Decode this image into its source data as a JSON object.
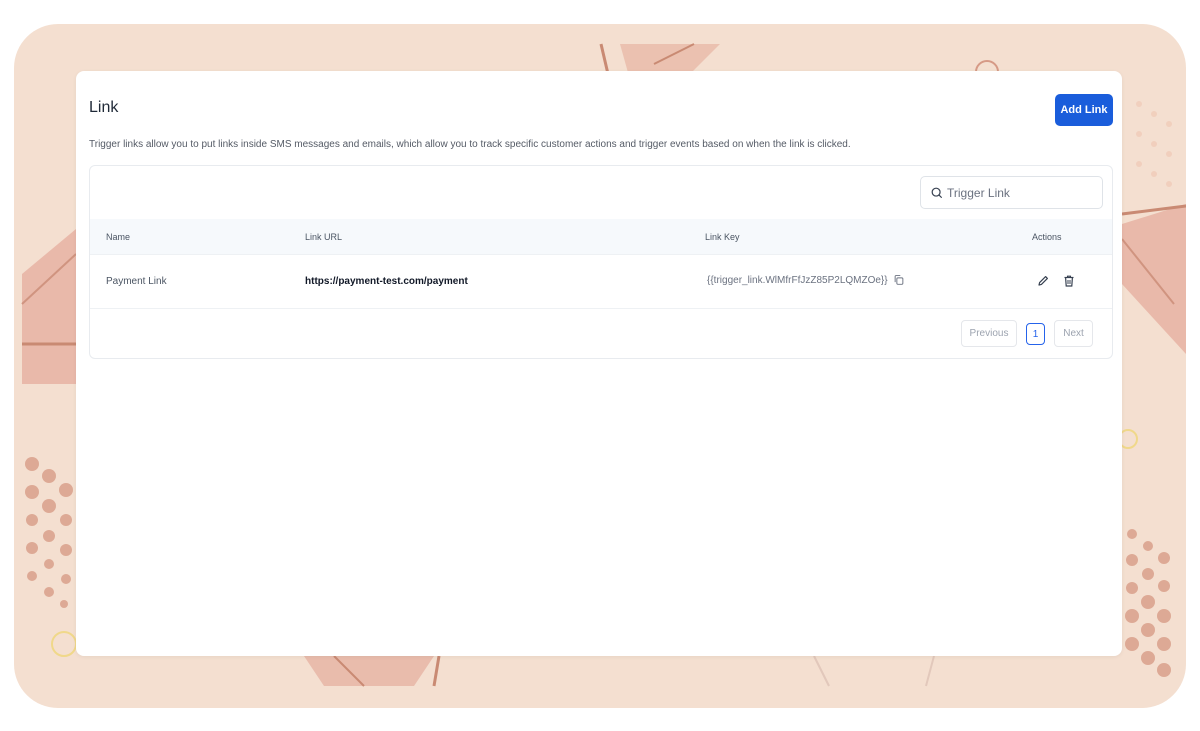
{
  "page": {
    "title": "Link",
    "add_button_label": "Add Link",
    "description": "Trigger links allow you to put links inside SMS messages and emails, which allow you to track specific customer actions and trigger events based on when the link is clicked."
  },
  "search": {
    "placeholder": "Trigger Link",
    "value": ""
  },
  "table": {
    "columns": [
      "Name",
      "Link URL",
      "Link Key",
      "Actions"
    ],
    "rows": [
      {
        "name": "Payment Link",
        "url": "https://payment-test.com/payment",
        "key": "{{trigger_link.WlMfrFfJzZ85P2LQMZOe}}"
      }
    ]
  },
  "pagination": {
    "previous_label": "Previous",
    "current_page": "1",
    "next_label": "Next"
  },
  "colors": {
    "accent": "#1a5ddb",
    "background": "#f4dfd0"
  },
  "icons": [
    "search-icon",
    "copy-icon",
    "edit-icon",
    "trash-icon"
  ]
}
